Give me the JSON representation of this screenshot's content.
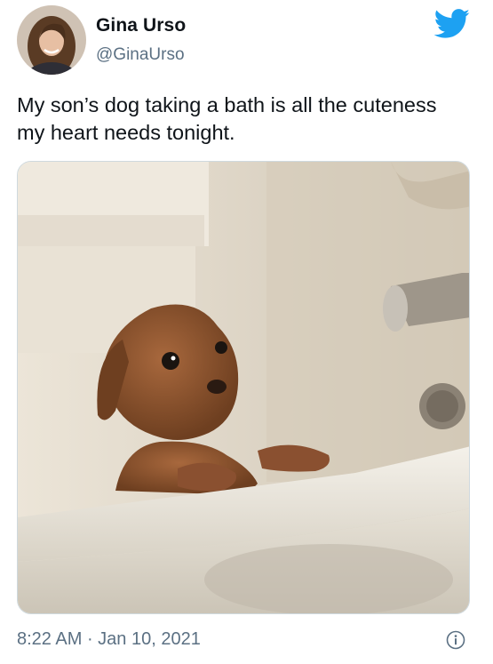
{
  "user": {
    "name": "Gina Urso",
    "handle": "@GinaUrso"
  },
  "tweet": {
    "text_line1": "My son’s dog taking a bath is all the cuteness",
    "text_line2": "my heart needs tonight."
  },
  "footer": {
    "time": "8:22 AM",
    "separator": " · ",
    "date": "Jan 10, 2021"
  },
  "icons": {
    "brand": "twitter-bird-icon",
    "info": "info-icon"
  },
  "colors": {
    "twitter_blue": "#1da1f2",
    "secondary_text": "#5b7083",
    "primary_text": "#0f1419",
    "border": "#cfd9de"
  }
}
